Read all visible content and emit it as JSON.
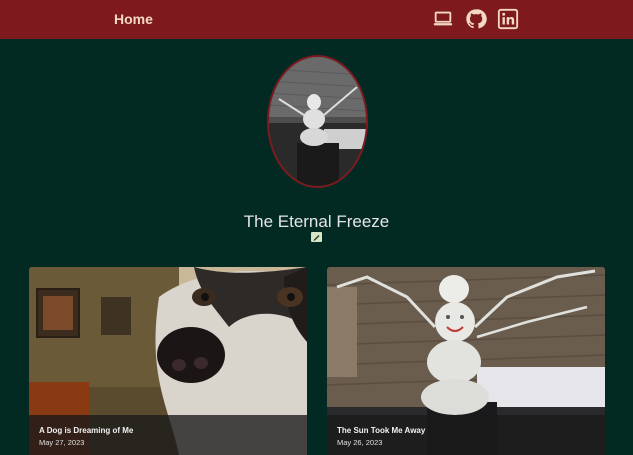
{
  "navbar": {
    "home_label": "Home",
    "icons": [
      "laptop-icon",
      "github-icon",
      "linkedin-icon"
    ],
    "background": "#7e1a1d",
    "text_color": "#f3d9c2"
  },
  "profile": {
    "avatar": "snowman-photo",
    "title": "The Eternal Freeze",
    "edit_icon": "edit-icon"
  },
  "posts": [
    {
      "title": "A Dog is Dreaming of Me",
      "date": "May 27, 2023",
      "image": "husky-photo"
    },
    {
      "title": "The Sun Took Me Away",
      "date": "May 26, 2023",
      "image": "snowman-photo"
    }
  ],
  "colors": {
    "page_background": "#022a22",
    "accent": "#7e1a1d"
  }
}
